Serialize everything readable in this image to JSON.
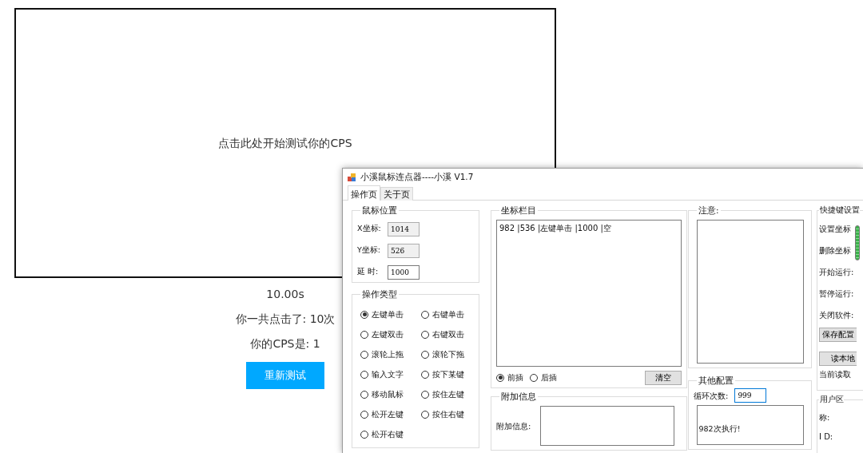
{
  "browser_page": {
    "prompt": "点击此处开始测试你的CPS",
    "timer": "10.00s",
    "clicks": "你一共点击了: 10次",
    "cps": "你的CPS是: 1",
    "retry_button": "重新测试"
  },
  "window": {
    "title": "小溪鼠标连点器----小溪 V1.7"
  },
  "tabs": [
    {
      "label": "操作页",
      "selected": true
    },
    {
      "label": "关于页",
      "selected": false
    }
  ],
  "mouse_position": {
    "title": "鼠标位置",
    "fields": [
      {
        "label": "X坐标:",
        "value": "1014",
        "disabled": true
      },
      {
        "label": "Y坐标:",
        "value": "526",
        "disabled": true
      },
      {
        "label": "延 时:",
        "value": "1000",
        "disabled": false
      }
    ]
  },
  "operation_type": {
    "title": "操作类型",
    "options": [
      {
        "label": "左键单击",
        "selected": true
      },
      {
        "label": "右键单击",
        "selected": false
      },
      {
        "label": "左键双击",
        "selected": false
      },
      {
        "label": "右键双击",
        "selected": false
      },
      {
        "label": "滚轮上拖",
        "selected": false
      },
      {
        "label": "滚轮下拖",
        "selected": false
      },
      {
        "label": "输入文字",
        "selected": false
      },
      {
        "label": "按下某键",
        "selected": false
      },
      {
        "label": "移动鼠标",
        "selected": false
      },
      {
        "label": "按住左键",
        "selected": false
      },
      {
        "label": "松开左键",
        "selected": false
      },
      {
        "label": "按住右键",
        "selected": false
      },
      {
        "label": "松开右键",
        "selected": false
      }
    ]
  },
  "coordinates": {
    "title": "坐标栏目",
    "entries": [
      "982 |536 |左键单击 |1000 |空"
    ],
    "insert_modes": [
      {
        "label": "前插",
        "selected": true
      },
      {
        "label": "后插",
        "selected": false
      }
    ],
    "clear_button": "清空"
  },
  "extra_info": {
    "title": "附加信息",
    "label": "附加信息:"
  },
  "notice": {
    "title": "注意:"
  },
  "other_config": {
    "title": "其他配置",
    "loop_label": "循环次数:",
    "loop_value": "999",
    "log": "982次执行!"
  },
  "hotkeys": {
    "title": "快捷键设置",
    "items": [
      "设置坐标",
      "删除坐标",
      "开始运行:",
      "暂停运行:",
      "关闭软件:"
    ],
    "save_button": "保存配置",
    "load_button": "读本地",
    "status": "当前读取"
  },
  "user_area": {
    "title": "用户区",
    "fields": [
      "称:",
      "I D:"
    ]
  }
}
